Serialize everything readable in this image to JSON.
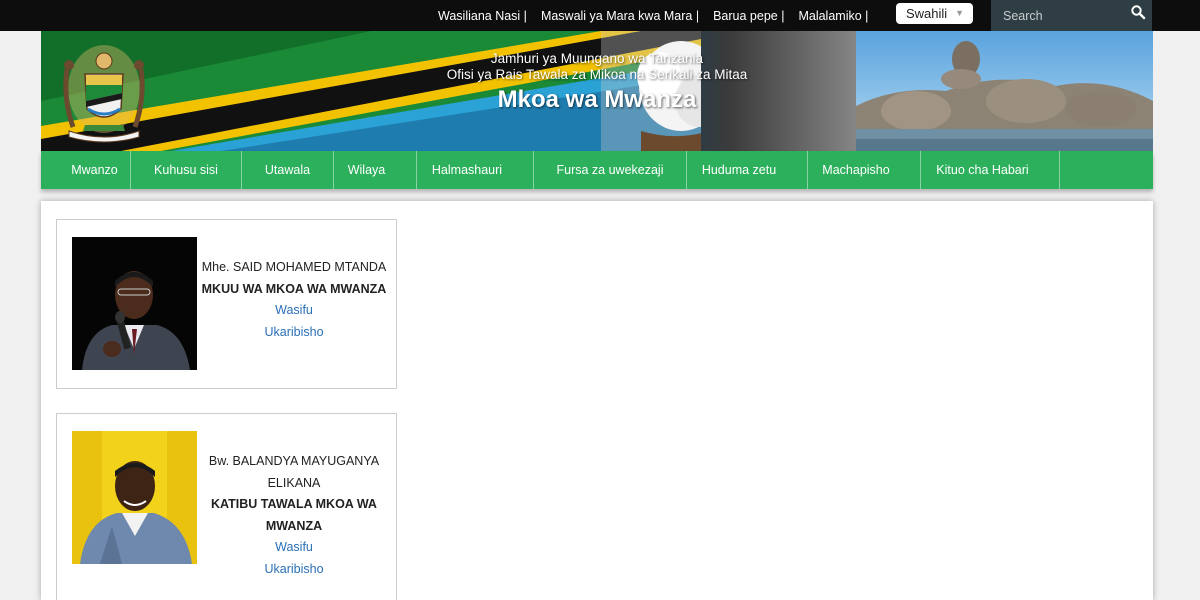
{
  "topbar": {
    "links": [
      "Wasiliana Nasi |",
      "Maswali ya Mara kwa Mara |",
      "Barua pepe |",
      "Malalamiko |"
    ],
    "language": "Swahili",
    "search_placeholder": "Search"
  },
  "banner": {
    "line1": "Jamhuri ya Muungano wa Tanzania",
    "line2": "Ofisi ya Rais Tawala za Mikoa na Serikali za Mitaa",
    "title": "Mkoa wa Mwanza"
  },
  "nav": {
    "items": [
      "Mwanzo",
      "Kuhusu sisi",
      "Utawala",
      "Wilaya",
      "Halmashauri",
      "Fursa za uwekezaji",
      "Huduma zetu",
      "Machapisho",
      "Kituo cha Habari"
    ]
  },
  "leaders": [
    {
      "name": "Mhe. SAID MOHAMED MTANDA",
      "role": "MKUU WA MKOA WA MWANZA",
      "link1": "Wasifu",
      "link2": "Ukaribisho"
    },
    {
      "name": "Bw. BALANDYA MAYUGANYA ELIKANA",
      "role": "KATIBU TAWALA MKOA WA MWANZA",
      "link1": "Wasifu",
      "link2": "Ukaribisho"
    }
  ],
  "colors": {
    "nav_green": "#2cb05c",
    "topbar": "#0d0d0d",
    "link_blue": "#2a6fb7"
  }
}
